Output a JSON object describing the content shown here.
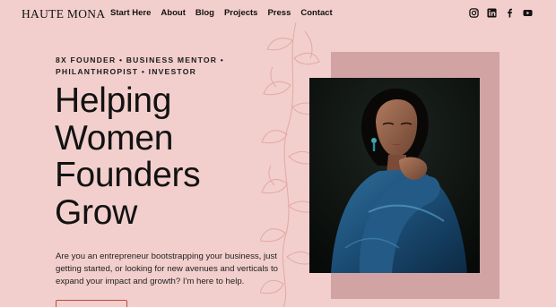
{
  "brand": {
    "logo_text": "HAUTE MONA"
  },
  "nav": {
    "items": [
      {
        "label": "Start Here"
      },
      {
        "label": "About"
      },
      {
        "label": "Blog"
      },
      {
        "label": "Projects"
      },
      {
        "label": "Press"
      },
      {
        "label": "Contact"
      }
    ]
  },
  "social": {
    "icons": [
      "instagram-icon",
      "linkedin-icon",
      "facebook-icon",
      "youtube-icon"
    ]
  },
  "hero": {
    "tagline_line1": "8X FOUNDER • BUSINESS MENTOR •",
    "tagline_line2": "PHILANTHROPIST • INVESTOR",
    "headline_lines": [
      "Helping",
      "Women",
      "Founders",
      "Grow"
    ],
    "intro": "Are you an entrepreneur bootstrapping your business, just getting started, or looking for new avenues and verticals to expand your impact and growth? I'm here to help."
  },
  "colors": {
    "background": "#f2cfcc",
    "accent_rect": "#d2a3a3",
    "cta_border": "#c0483b",
    "leaf": "#e3a8a3"
  }
}
